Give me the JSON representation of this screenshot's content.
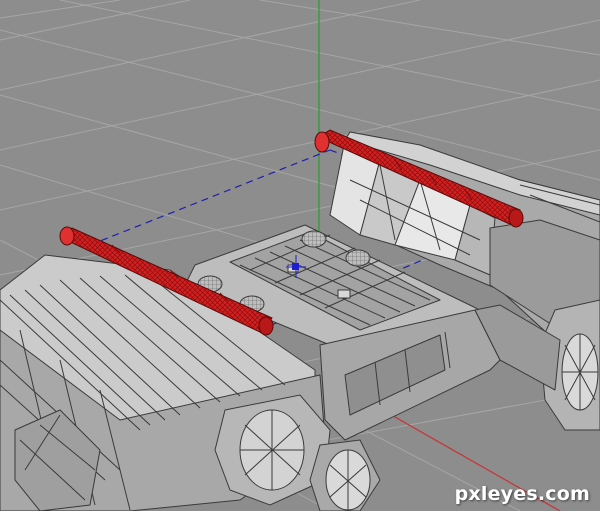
{
  "viewport": {
    "name": "3d-perspective-viewport",
    "model": "sci-fi-vehicle-wireframe"
  },
  "colors": {
    "background": "#8d8d8d",
    "grid": "#a6a6a6",
    "hull_light": "#c9c9c9",
    "hull_mid": "#a9a9a9",
    "hull_dark": "#6d6d6d",
    "wire": "#3a3a3a",
    "highlight_red": "#d42020",
    "axis_y": "#1fa51f",
    "axis_x": "#c83232",
    "axis_z": "#2020c8",
    "selection_dash": "#1f1fb0"
  },
  "watermark": {
    "text": "pxleyes.com"
  }
}
